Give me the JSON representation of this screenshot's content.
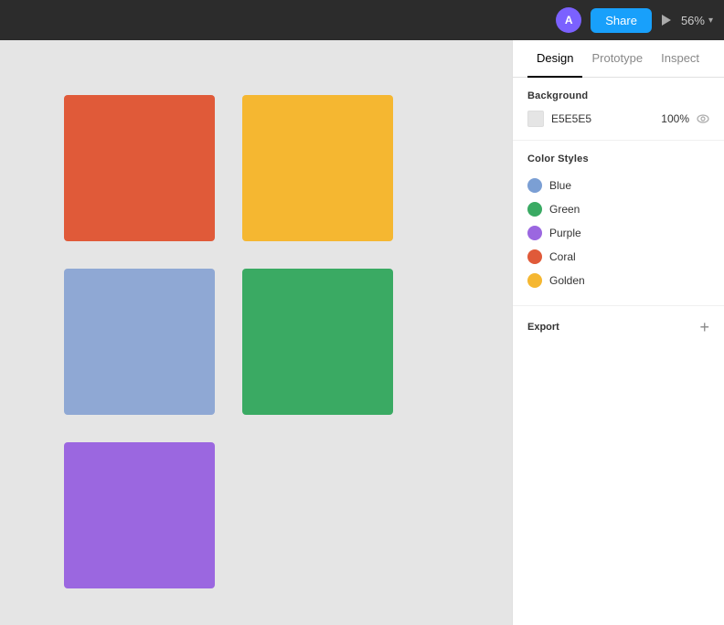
{
  "topbar": {
    "avatar_label": "A",
    "share_label": "Share",
    "zoom_label": "56%"
  },
  "canvas": {
    "background_color": "#e5e5e5",
    "squares": [
      {
        "id": "coral-square",
        "color": "#e05a39"
      },
      {
        "id": "golden-square",
        "color": "#f5b731"
      },
      {
        "id": "blue-square",
        "color": "#8fa8d4"
      },
      {
        "id": "green-square",
        "color": "#3aaa63"
      },
      {
        "id": "purple-square",
        "color": "#9b67e0"
      },
      {
        "id": "empty-square",
        "color": "transparent"
      }
    ]
  },
  "panel": {
    "tabs": [
      {
        "id": "design",
        "label": "Design",
        "active": true
      },
      {
        "id": "prototype",
        "label": "Prototype",
        "active": false
      },
      {
        "id": "inspect",
        "label": "Inspect",
        "active": false
      }
    ],
    "background_section": {
      "title": "Background",
      "hex": "E5E5E5",
      "opacity": "100%"
    },
    "color_styles_section": {
      "title": "Color Styles",
      "items": [
        {
          "name": "Blue",
          "color": "#7b9fd4"
        },
        {
          "name": "Green",
          "color": "#3aaa63"
        },
        {
          "name": "Purple",
          "color": "#9b67e0"
        },
        {
          "name": "Coral",
          "color": "#e05a39"
        },
        {
          "name": "Golden",
          "color": "#f5b731"
        }
      ]
    },
    "export_section": {
      "title": "Export"
    }
  }
}
